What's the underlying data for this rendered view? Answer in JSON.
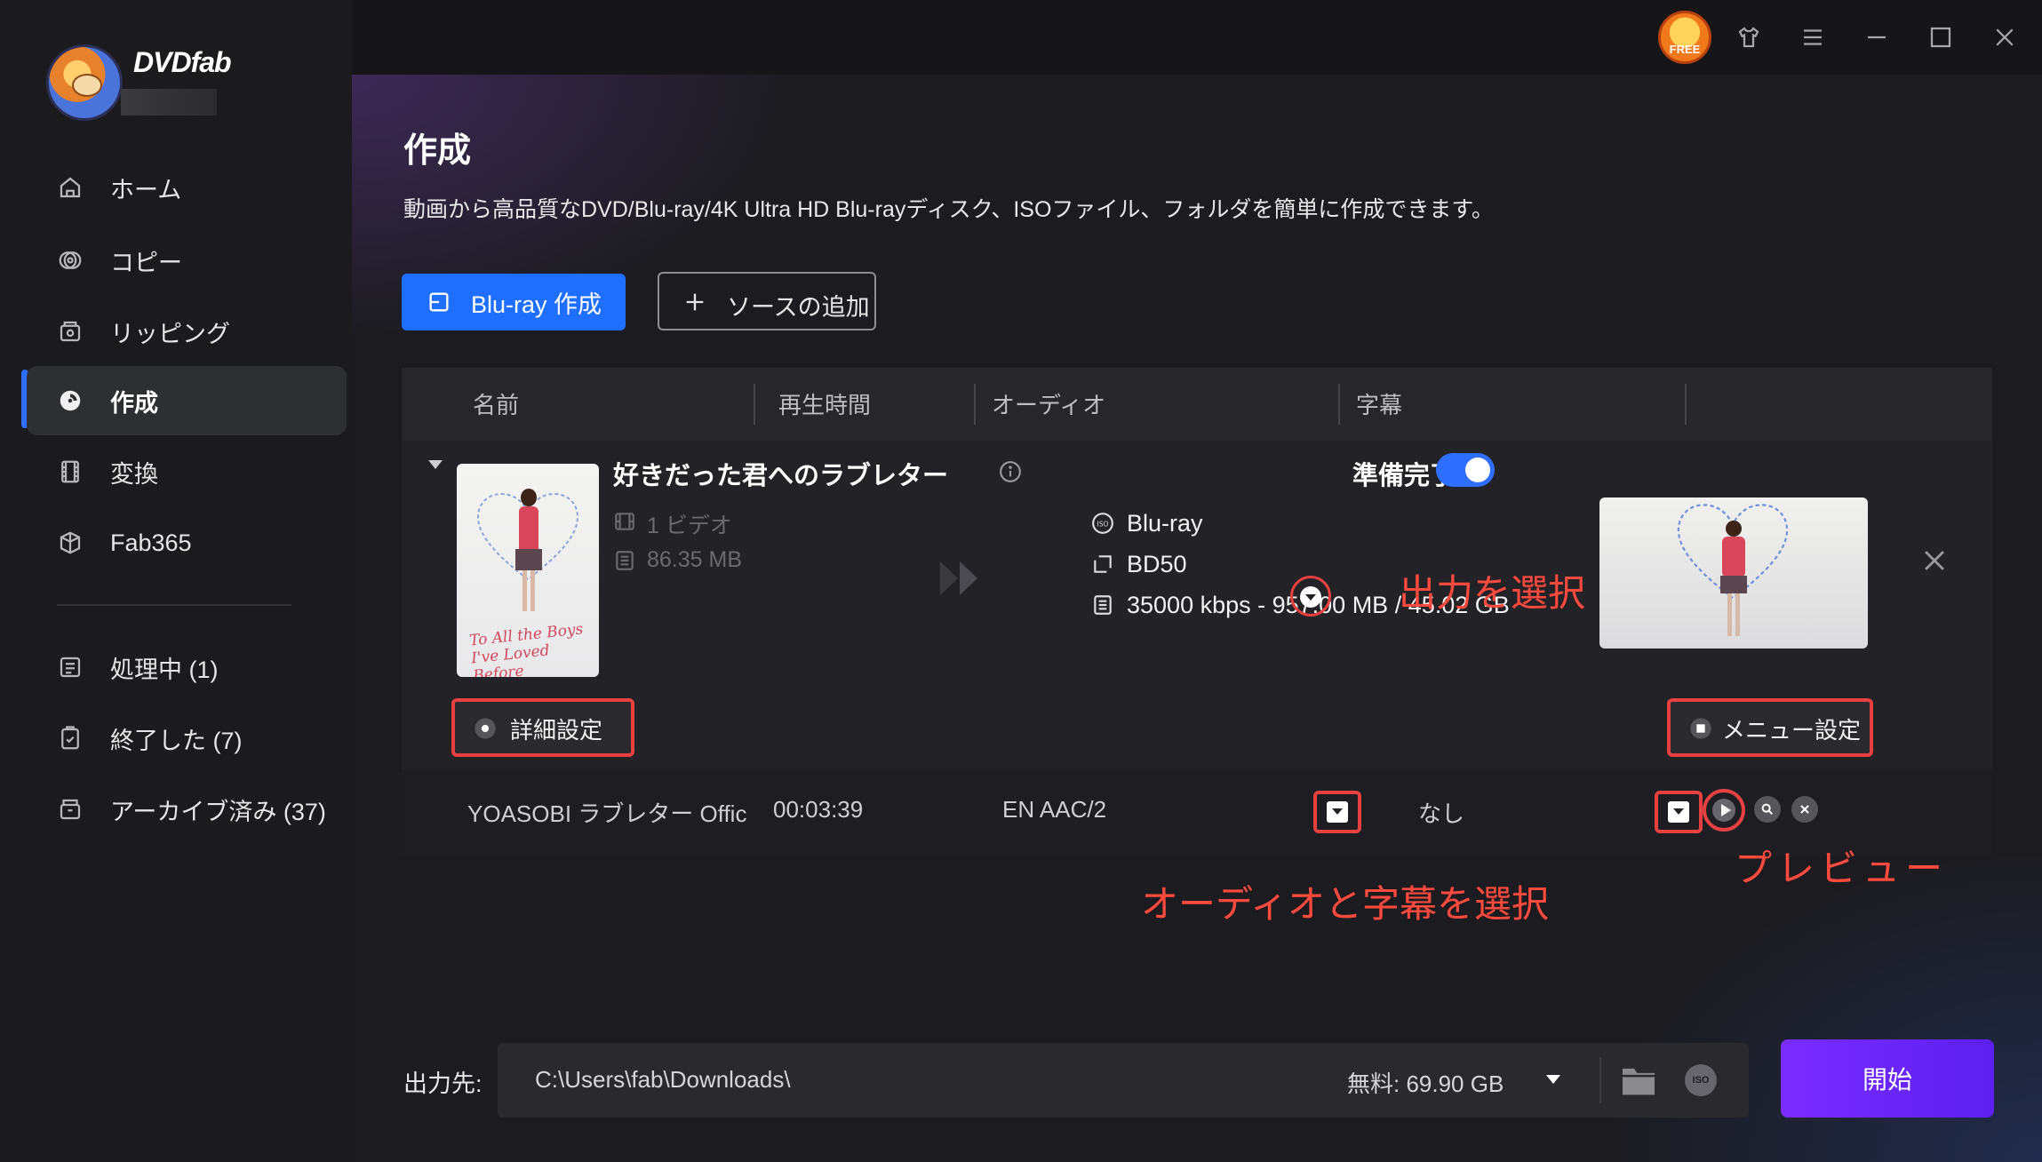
{
  "app": {
    "brand": "DVDfab"
  },
  "sidebar": {
    "items": [
      {
        "label": "ホーム"
      },
      {
        "label": "コピー"
      },
      {
        "label": "リッピング"
      },
      {
        "label": "作成"
      },
      {
        "label": "変換"
      },
      {
        "label": "Fab365"
      }
    ],
    "queue": [
      {
        "label": "処理中 (1)"
      },
      {
        "label": "終了した (7)"
      },
      {
        "label": "アーカイブ済み (37)"
      }
    ]
  },
  "titlebar": {
    "free_badge": "FREE"
  },
  "page": {
    "title": "作成",
    "description": "動画から高品質なDVD/Blu-ray/4K Ultra HD Blu-rayディスク、ISOファイル、フォルダを簡単に作成できます。"
  },
  "toolbar": {
    "create_label": "Blu-ray 作成",
    "add_source_label": "ソースの追加"
  },
  "table": {
    "headers": [
      "名前",
      "再生時間",
      "オーディオ",
      "字幕"
    ],
    "title": {
      "name": "好きだった君へのラブレター",
      "ready_label": "準備完了",
      "ready": true,
      "poster_text": "To All the Boys I've Loved Before",
      "source": {
        "videos": "1 ビデオ",
        "size": "86.35 MB"
      },
      "output": {
        "format": "Blu-ray",
        "disc": "BD50",
        "bitrate": "35000 kbps - 957.00 MB / 45.02 GB"
      },
      "advanced_label": "詳細設定",
      "menu_label": "メニュー設定"
    },
    "track": {
      "name": "YOASOBI  ラブレター  Offic",
      "duration": "00:03:39",
      "audio": "EN  AAC/2",
      "subtitle": "なし"
    }
  },
  "annotations": {
    "output": "出力を選択",
    "audio_subtitle": "オーディオと字幕を選択",
    "preview": "プレビュー"
  },
  "destination": {
    "label": "出力先:",
    "path": "C:\\Users\\fab\\Downloads\\",
    "free_space": "無料: 69.90 GB",
    "iso_icon_text": "ISO"
  },
  "start_label": "開始",
  "colors": {
    "accent_blue": "#1f6fff",
    "start_purple": "#6a26f8",
    "annotation_red": "#e64040"
  }
}
